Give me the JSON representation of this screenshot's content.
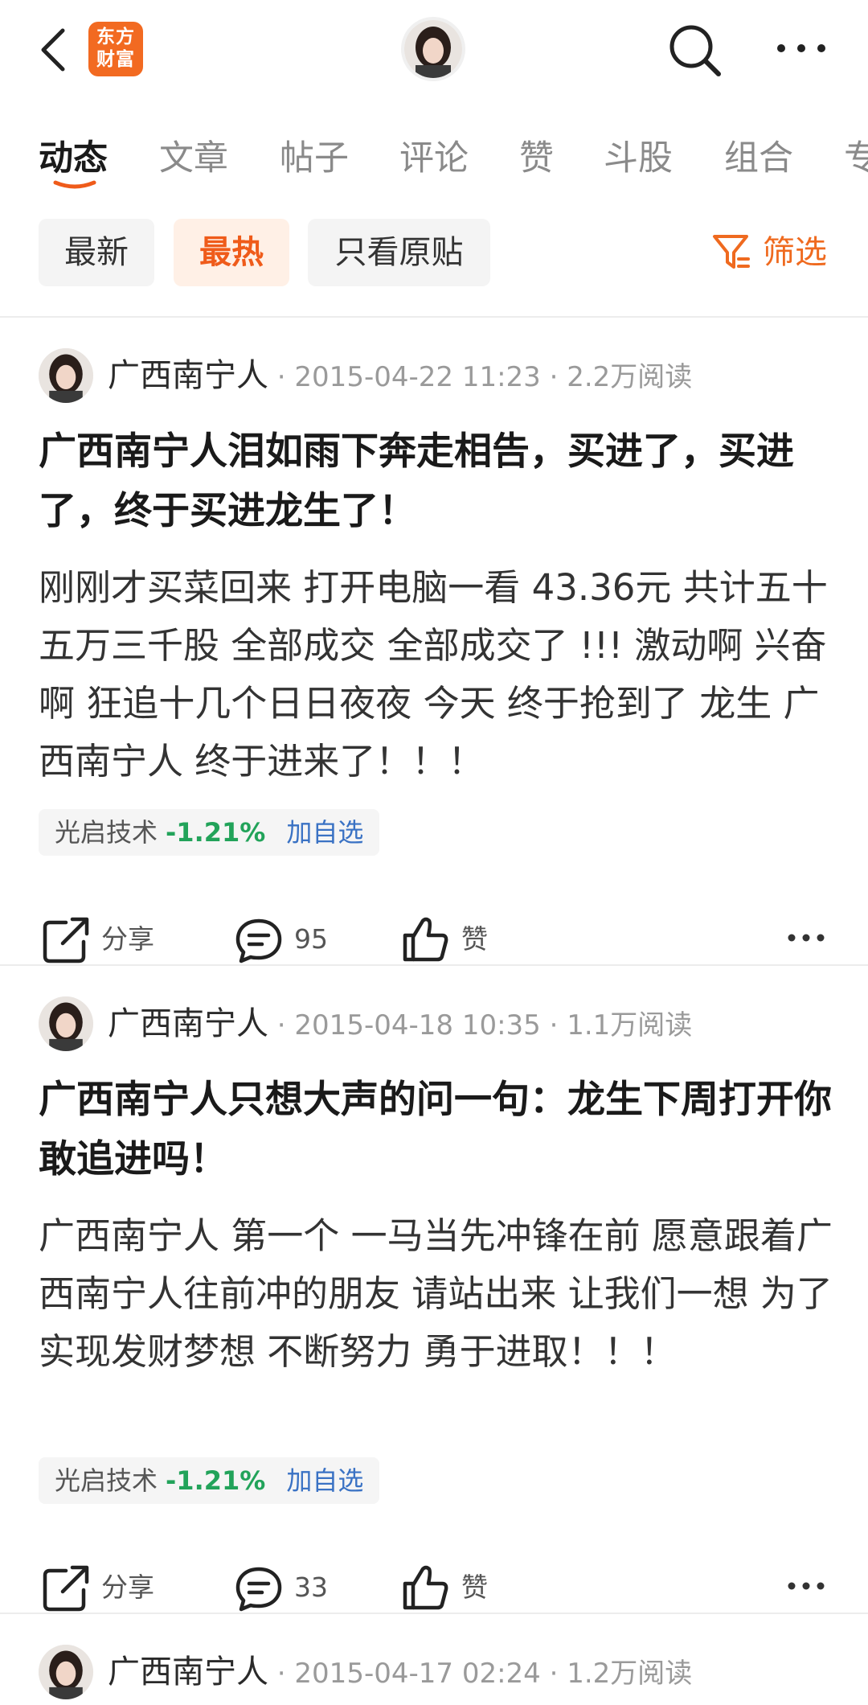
{
  "header": {
    "logo_text_line1": "东方",
    "logo_text_line2": "财富",
    "brand_color": "#f26a21"
  },
  "tabs": [
    {
      "label": "动态",
      "active": true
    },
    {
      "label": "文章"
    },
    {
      "label": "帖子"
    },
    {
      "label": "评论"
    },
    {
      "label": "赞"
    },
    {
      "label": "斗股"
    },
    {
      "label": "组合"
    },
    {
      "label": "专"
    }
  ],
  "filters": {
    "chips": [
      {
        "label": "最新"
      },
      {
        "label": "最热",
        "active": true
      },
      {
        "label": "只看原贴"
      }
    ],
    "filter_label": "筛选",
    "accent": "#ef6a1f"
  },
  "posts": [
    {
      "author": "广西南宁人",
      "meta": " · 2015-04-22 11:23 · 2.2万阅读",
      "title": "广西南宁人泪如雨下奔走相告，买进了，买进了，终于买进龙生了！",
      "body": "刚刚才买菜回来 打开电脑一看 43.36元 共计五十五万三千股 全部成交 全部成交了 !!! 激动啊 兴奋啊 狂追十几个日日夜夜 今天 终于抢到了 龙生 广西南宁人 终于进来了！！！",
      "stock": {
        "name": "光启技术",
        "change": "-1.21%",
        "add": "加自选"
      },
      "share_label": "分享",
      "comment_count": "95",
      "like_label": "赞"
    },
    {
      "author": "广西南宁人",
      "meta": " · 2015-04-18 10:35 · 1.1万阅读",
      "title": "广西南宁人只想大声的问一句：龙生下周打开你敢追进吗！",
      "body": "广西南宁人 第一个 一马当先冲锋在前 愿意跟着广西南宁人往前冲的朋友 请站出来 让我们一想 为了实现发财梦想 不断努力 勇于进取！！！",
      "stock": {
        "name": "光启技术",
        "change": "-1.21%",
        "add": "加自选"
      },
      "share_label": "分享",
      "comment_count": "33",
      "like_label": "赞"
    },
    {
      "author": "广西南宁人",
      "meta": " · 2015-04-17 02:24 · 1.2万阅读"
    }
  ],
  "icons": {
    "back": "chevron-left-icon",
    "search": "search-icon",
    "more": "more-horizontal-icon",
    "filter": "filter-icon",
    "share": "share-icon",
    "comment": "comment-icon",
    "like": "thumbs-up-icon"
  }
}
